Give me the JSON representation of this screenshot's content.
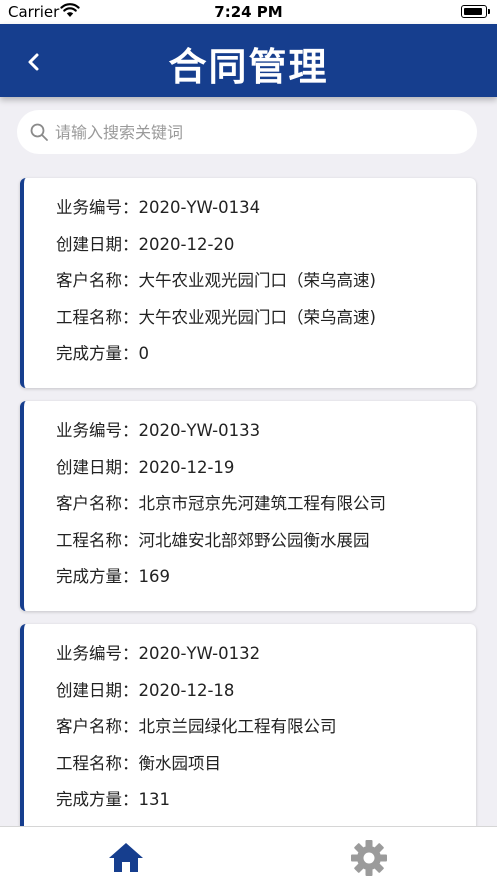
{
  "status_bar": {
    "carrier": "Carrier",
    "time": "7:24 PM"
  },
  "nav": {
    "title": "合同管理",
    "back_icon": "chevron-left-icon"
  },
  "search": {
    "placeholder": "请输入搜索关键词",
    "value": "",
    "icon": "search-icon"
  },
  "labels": {
    "business_no": "业务编号：",
    "created_date": "创建日期：",
    "customer_name": "客户名称：",
    "project_name": "工程名称：",
    "completed_qty": "完成方量："
  },
  "contracts": [
    {
      "business_no": "2020-YW-0134",
      "created_date": "2020-12-20",
      "customer_name": "大午农业观光园门口（荣乌高速)",
      "project_name": "大午农业观光园门口（荣乌高速)",
      "completed_qty": "0"
    },
    {
      "business_no": "2020-YW-0133",
      "created_date": "2020-12-19",
      "customer_name": "北京市冠京先河建筑工程有限公司",
      "project_name": "河北雄安北部郊野公园衡水展园",
      "completed_qty": "169"
    },
    {
      "business_no": "2020-YW-0132",
      "created_date": "2020-12-18",
      "customer_name": "北京兰园绿化工程有限公司",
      "project_name": "衡水园项目",
      "completed_qty": "131"
    }
  ],
  "tab_bar": {
    "home_icon": "home-icon",
    "settings_icon": "gear-icon"
  },
  "colors": {
    "primary": "#163e8e",
    "background": "#f0eff4",
    "tab_active": "#163e8e",
    "tab_inactive": "#9b9b9b"
  }
}
